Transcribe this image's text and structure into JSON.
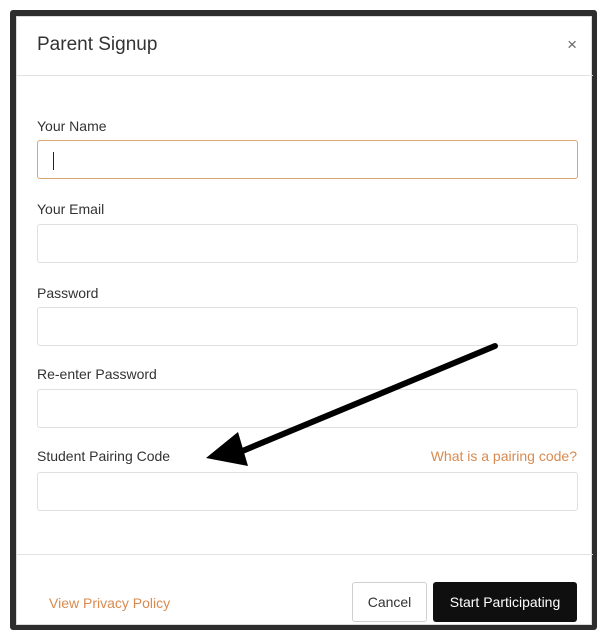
{
  "modal": {
    "title": "Parent Signup",
    "close_glyph": "×"
  },
  "fields": {
    "name_label": "Your Name",
    "email_label": "Your Email",
    "password_label": "Password",
    "reenter_label": "Re-enter Password",
    "pairing_label": "Student Pairing Code",
    "pairing_help_link": "What is a pairing code?"
  },
  "footer": {
    "privacy_link": "View Privacy Policy",
    "cancel_label": "Cancel",
    "submit_label": "Start Participating"
  },
  "icons": {
    "close": "close-icon",
    "annotation": "arrow-annotation-icon"
  },
  "colors": {
    "link_accent": "#d98a4f",
    "focus_border": "#d9a774",
    "primary_button": "#0f0f0f",
    "frame": "#2d2d2d"
  }
}
